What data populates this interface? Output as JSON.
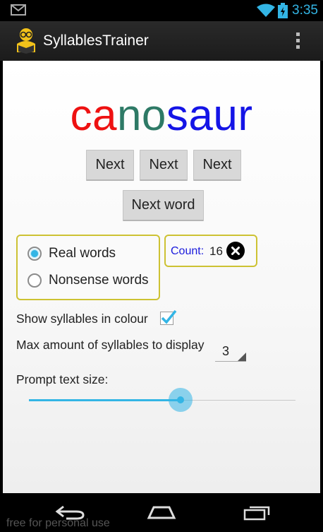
{
  "status_bar": {
    "time": "3:35",
    "icons": [
      "mail-icon",
      "wifi-icon",
      "battery-icon"
    ]
  },
  "action_bar": {
    "app_icon": "reader-icon",
    "title": "SyllablesTrainer",
    "overflow_icon": "overflow-menu-icon"
  },
  "prompt": {
    "syllables": [
      {
        "text": "ca",
        "color": "#ee1111"
      },
      {
        "text": "no",
        "color": "#2e7a66"
      },
      {
        "text": "saur",
        "color": "#1414e6"
      }
    ]
  },
  "buttons": {
    "next_1": "Next",
    "next_2": "Next",
    "next_3": "Next",
    "next_word": "Next word"
  },
  "word_type": {
    "options": [
      {
        "label": "Real words",
        "selected": true
      },
      {
        "label": "Nonsense words",
        "selected": false
      }
    ]
  },
  "counter": {
    "label": "Count:",
    "value": "16",
    "clear_icon": "close-circle-icon"
  },
  "settings": {
    "show_colour_label": "Show syllables in colour",
    "show_colour_checked": true,
    "max_syllables_label": "Max amount of syllables to display",
    "max_syllables_value": "3",
    "prompt_size_label": "Prompt text size:",
    "prompt_size_level": 0.57
  },
  "nav_bar": {
    "icons": [
      "back-icon",
      "home-icon",
      "recent-apps-icon"
    ]
  },
  "watermark": "free for personal use",
  "colors": {
    "accent": "#33b5e5",
    "group_border": "#cdc233",
    "count_label": "#1a1adc"
  }
}
